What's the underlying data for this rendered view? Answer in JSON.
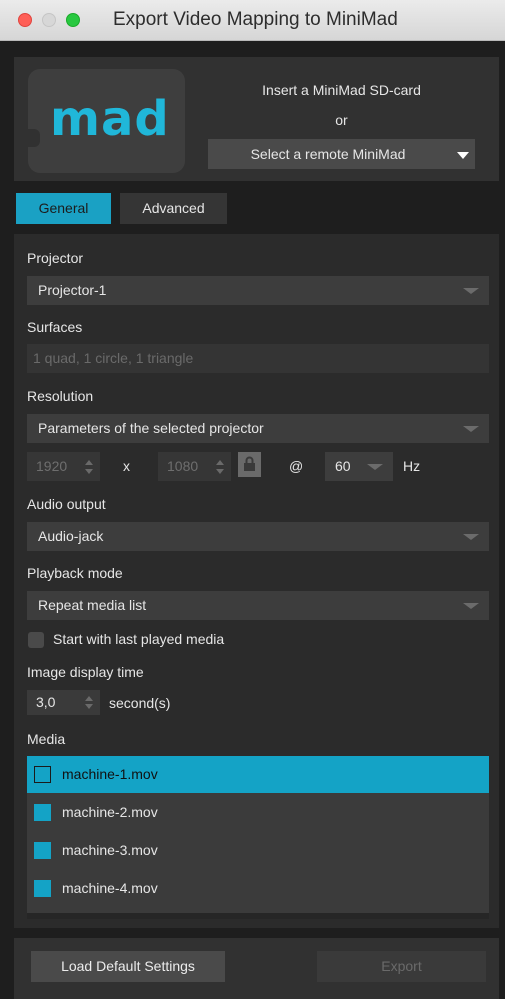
{
  "window": {
    "title": "Export Video Mapping to MiniMad"
  },
  "header": {
    "logo_text": "mad",
    "insert_text": "Insert a MiniMad SD-card",
    "or_text": "or",
    "remote_select_label": "Select a remote MiniMad"
  },
  "tabs": [
    {
      "label": "General",
      "active": true
    },
    {
      "label": "Advanced",
      "active": false
    }
  ],
  "projector": {
    "label": "Projector",
    "value": "Projector-1"
  },
  "surfaces": {
    "label": "Surfaces",
    "value": "1 quad, 1 circle, 1 triangle"
  },
  "resolution": {
    "label": "Resolution",
    "value": "Parameters of the selected projector",
    "width": "1920",
    "x_symbol": "x",
    "height": "1080",
    "at_symbol": "@",
    "refresh": "60",
    "hz_label": "Hz"
  },
  "audio": {
    "label": "Audio output",
    "value": "Audio-jack"
  },
  "playback": {
    "label": "Playback mode",
    "value": "Repeat media list",
    "start_last_label": "Start with last played media",
    "start_last_checked": false
  },
  "image_display": {
    "label": "Image display time",
    "value": "3,0",
    "unit": "second(s)"
  },
  "media": {
    "label": "Media",
    "items": [
      {
        "name": "machine-1.mov",
        "selected": true
      },
      {
        "name": "machine-2.mov",
        "selected": false
      },
      {
        "name": "machine-3.mov",
        "selected": false
      },
      {
        "name": "machine-4.mov",
        "selected": false
      }
    ]
  },
  "footer": {
    "load_default_label": "Load Default Settings",
    "export_label": "Export"
  },
  "colors": {
    "accent": "#14a3c6",
    "panel": "#2b2b2b",
    "background": "#1e1e1e"
  }
}
